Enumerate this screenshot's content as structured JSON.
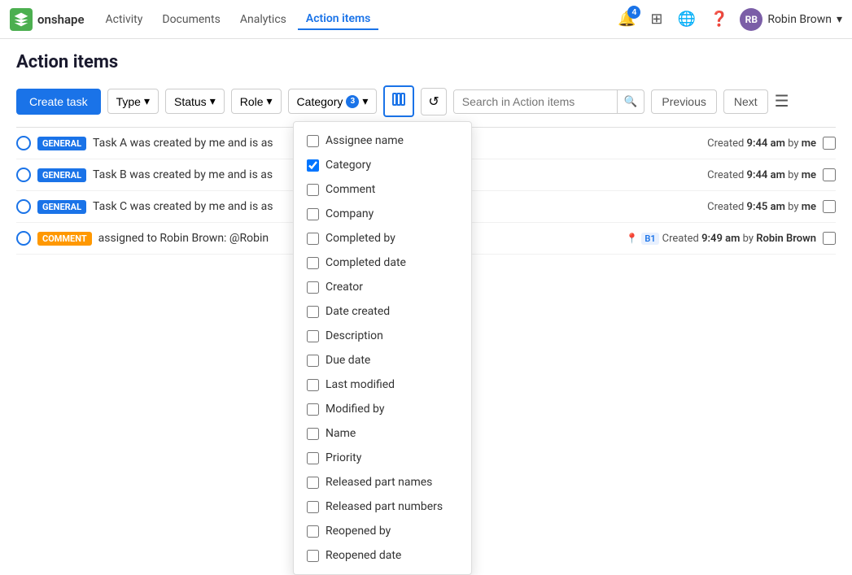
{
  "navbar": {
    "logo_text": "onshape",
    "links": [
      {
        "label": "Activity",
        "active": false
      },
      {
        "label": "Documents",
        "active": false
      },
      {
        "label": "Analytics",
        "active": false
      },
      {
        "label": "Action items",
        "active": true
      }
    ],
    "notification_count": "4",
    "user_name": "Robin Brown",
    "user_initials": "RB"
  },
  "page": {
    "title": "Action items"
  },
  "toolbar": {
    "create_label": "Create task",
    "type_label": "Type",
    "status_label": "Status",
    "role_label": "Role",
    "category_label": "Category",
    "category_badge": "3",
    "search_placeholder": "Search in Action items",
    "prev_label": "Previous",
    "next_label": "Next"
  },
  "tasks": [
    {
      "id": "a",
      "tag": "GENERAL",
      "tag_type": "general",
      "text": "Task A was created by me and is as",
      "meta_time": "9:44 am",
      "meta_by": "me",
      "pin": false,
      "b1": false
    },
    {
      "id": "b",
      "tag": "GENERAL",
      "tag_type": "general",
      "text": "Task B was created by me and is as",
      "meta_time": "9:44 am",
      "meta_by": "me",
      "pin": false,
      "b1": false
    },
    {
      "id": "c",
      "tag": "GENERAL",
      "tag_type": "general",
      "text": "Task C was created by me and is as",
      "meta_time": "9:45 am",
      "meta_by": "me",
      "pin": false,
      "b1": false
    },
    {
      "id": "d",
      "tag": "COMMENT",
      "tag_type": "comment",
      "text": "assigned to Robin Brown: @Robin",
      "meta_time": "9:49 am",
      "meta_by": "Robin Brown",
      "pin": true,
      "b1": true
    }
  ],
  "dropdown": {
    "items": [
      {
        "label": "Assignee name",
        "checked": false
      },
      {
        "label": "Category",
        "checked": true
      },
      {
        "label": "Comment",
        "checked": false
      },
      {
        "label": "Company",
        "checked": false
      },
      {
        "label": "Completed by",
        "checked": false
      },
      {
        "label": "Completed date",
        "checked": false
      },
      {
        "label": "Creator",
        "checked": false
      },
      {
        "label": "Date created",
        "checked": false
      },
      {
        "label": "Description",
        "checked": false
      },
      {
        "label": "Due date",
        "checked": false
      },
      {
        "label": "Last modified",
        "checked": false
      },
      {
        "label": "Modified by",
        "checked": false
      },
      {
        "label": "Name",
        "checked": false
      },
      {
        "label": "Priority",
        "checked": false
      },
      {
        "label": "Released part names",
        "checked": false
      },
      {
        "label": "Released part numbers",
        "checked": false
      },
      {
        "label": "Reopened by",
        "checked": false
      },
      {
        "label": "Reopened date",
        "checked": false
      }
    ]
  }
}
